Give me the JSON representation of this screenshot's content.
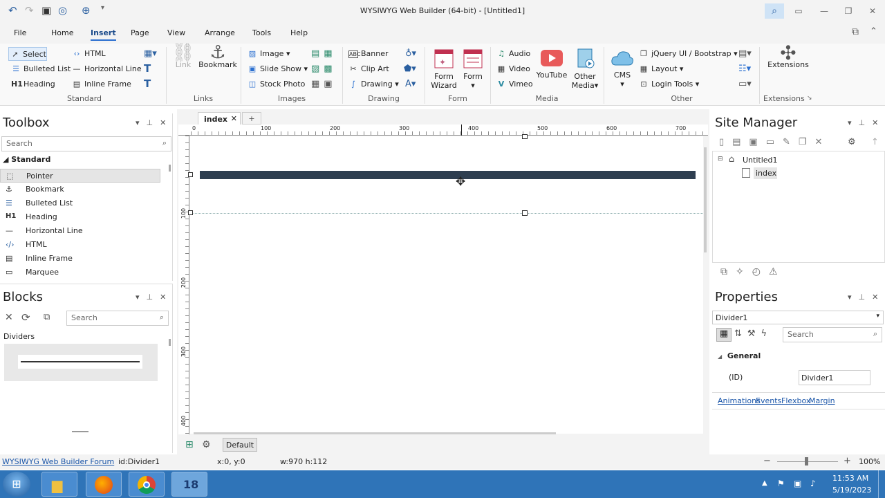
{
  "window": {
    "title": "WYSIWYG Web Builder (64-bit) - [Untitled1]"
  },
  "menu": {
    "items": [
      "File",
      "Home",
      "Insert",
      "Page",
      "View",
      "Arrange",
      "Tools",
      "Help"
    ],
    "active": "Insert"
  },
  "ribbon": {
    "standard": {
      "select": "Select",
      "html": "HTML",
      "bulleted_list": "Bulleted List",
      "horizontal_line": "Horizontal Line",
      "heading": "Heading",
      "inline_frame": "Inline Frame",
      "group": "Standard"
    },
    "links": {
      "link": "Link",
      "bookmark": "Bookmark",
      "group": "Links"
    },
    "images": {
      "image": "Image",
      "slide_show": "Slide Show",
      "stock_photo": "Stock Photo",
      "group": "Images"
    },
    "drawing": {
      "banner": "Banner",
      "clip_art": "Clip Art",
      "drawing": "Drawing",
      "group": "Drawing"
    },
    "form": {
      "form_wizard_1": "Form",
      "form_wizard_2": "Wizard",
      "form": "Form",
      "group": "Form"
    },
    "media": {
      "audio": "Audio",
      "video": "Video",
      "vimeo": "Vimeo",
      "youtube": "YouTube",
      "other_1": "Other",
      "other_2": "Media",
      "group": "Media"
    },
    "other": {
      "cms": "CMS",
      "jquery": "jQuery UI / Bootstrap",
      "layout": "Layout",
      "login_tools": "Login Tools",
      "group": "Other"
    },
    "extensions": {
      "extensions": "Extensions",
      "group": "Extensions"
    }
  },
  "toolbox": {
    "title": "Toolbox",
    "search_placeholder": "Search",
    "category": "Standard",
    "items": [
      {
        "icon": "pointer-icon",
        "label": "Pointer"
      },
      {
        "icon": "anchor-icon",
        "label": "Bookmark"
      },
      {
        "icon": "list-icon",
        "label": "Bulleted List"
      },
      {
        "icon": "h1-icon",
        "label": "Heading"
      },
      {
        "icon": "line-icon",
        "label": "Horizontal Line"
      },
      {
        "icon": "code-icon",
        "label": "HTML"
      },
      {
        "icon": "frame-icon",
        "label": "Inline Frame"
      },
      {
        "icon": "marquee-icon",
        "label": "Marquee"
      }
    ]
  },
  "blocks": {
    "title": "Blocks",
    "search_placeholder": "Search",
    "category": "Dividers"
  },
  "document": {
    "tab": "index",
    "add_tab": "+",
    "bottom_tab": "Default",
    "ruler": [
      "0",
      "100",
      "200",
      "300",
      "400",
      "500",
      "600",
      "700"
    ],
    "vruler": [
      "100",
      "200",
      "300",
      "400"
    ]
  },
  "site_manager": {
    "title": "Site Manager",
    "root": "Untitled1",
    "page": "index"
  },
  "properties": {
    "title": "Properties",
    "selected": "Divider1",
    "search_placeholder": "Search",
    "section": "General",
    "id_label": "(ID)",
    "id_value": "Divider1",
    "links": [
      "Animations",
      "Events",
      "Flexbox",
      "Margin"
    ]
  },
  "status": {
    "forum": "WYSIWYG Web Builder Forum",
    "id": "id:Divider1",
    "pos": "x:0, y:0",
    "size": "w:970 h:112",
    "zoom": "100%"
  },
  "taskbar": {
    "time": "11:53 AM",
    "date": "5/19/2023",
    "badge": "18"
  },
  "colors": {
    "accent": "#2a6fd0",
    "divider": "#2e3e50",
    "taskbar": "#2f74b8"
  }
}
